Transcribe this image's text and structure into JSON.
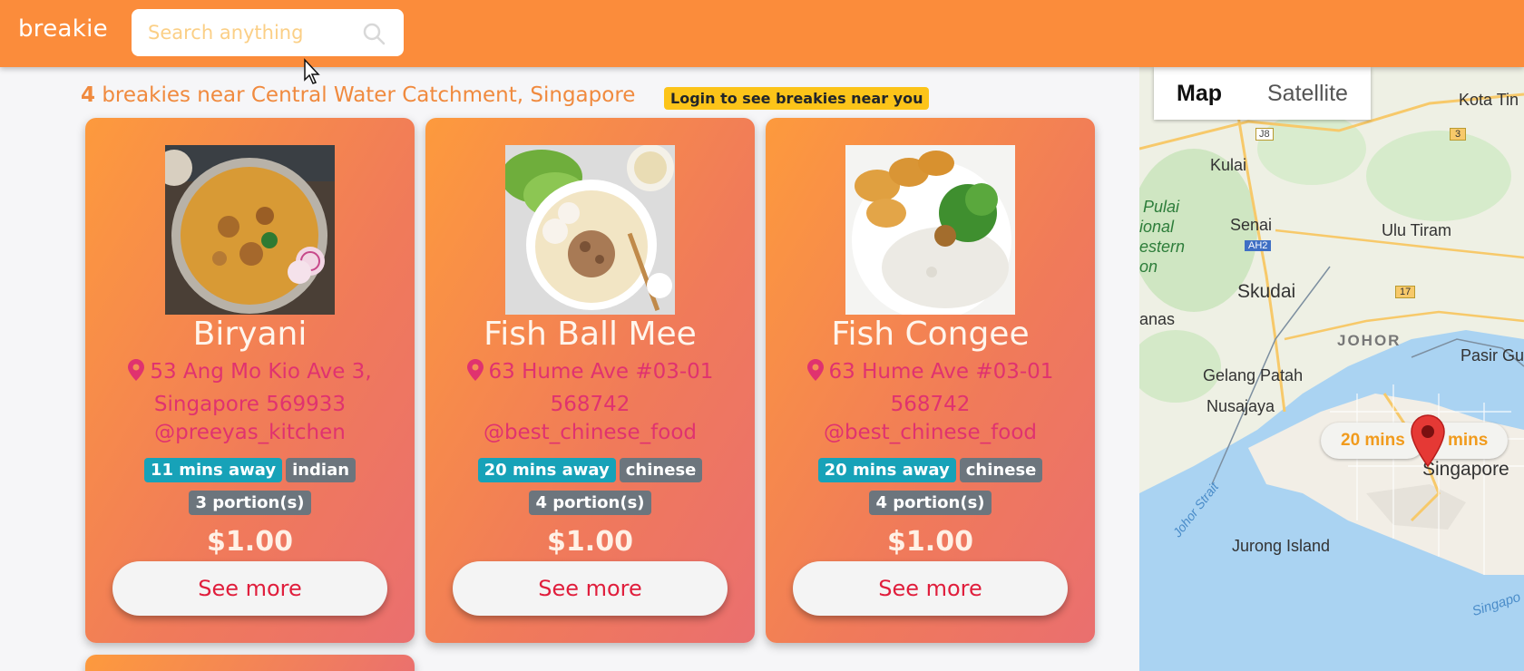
{
  "app": {
    "brand": "breakie"
  },
  "search": {
    "placeholder": "Search anything"
  },
  "heading": {
    "count": "4",
    "text": " breakies near Central Water Catchment, Singapore",
    "login_badge": "Login to see breakies near you"
  },
  "cards": [
    {
      "title": "Biryani",
      "address": "53 Ang Mo Kio Ave 3, Singapore 569933",
      "handle": "@preeyas_kitchen",
      "distance": "11 mins away",
      "cuisine": "indian",
      "portions": "3 portion(s)",
      "price": "$1.00",
      "button": "See more"
    },
    {
      "title": "Fish Ball Mee",
      "address": "63 Hume Ave #03-01 568742",
      "handle": "@best_chinese_food",
      "distance": "20 mins away",
      "cuisine": "chinese",
      "portions": "4 portion(s)",
      "price": "$1.00",
      "button": "See more"
    },
    {
      "title": "Fish Congee",
      "address": "63 Hume Ave #03-01 568742",
      "handle": "@best_chinese_food",
      "distance": "20 mins away",
      "cuisine": "chinese",
      "portions": "4 portion(s)",
      "price": "$1.00",
      "button": "See more"
    }
  ],
  "map": {
    "toggle": [
      "Map",
      "Satellite"
    ],
    "labels": [
      "Kota Tin",
      "Kulai",
      "Senai",
      "Ulu Tiram",
      "Skudai",
      "JOHOR",
      "Pasir Gu",
      "Gelang Patah",
      "Nusajaya",
      "Singapore",
      "Jurong Island",
      "anas"
    ],
    "green_labels": [
      "Pulai",
      "ional",
      "estern",
      "on"
    ],
    "water_labels": [
      "Johor Strait",
      "Singapo"
    ],
    "road_markers": [
      "J8",
      "3",
      "AH2",
      "17"
    ],
    "bubbles": [
      "20 mins",
      "mins"
    ]
  },
  "colors": {
    "navbar": "#fb8c3b",
    "accent_text": "#f08a3e",
    "pink_text": "#e0326f",
    "badge_info": "#17a2b8",
    "badge_grey": "#6c757d",
    "button_text": "#e01e3c"
  },
  "icons": [
    "search-icon",
    "map-pin-icon",
    "map-marker-icon",
    "mouse-cursor-icon"
  ]
}
